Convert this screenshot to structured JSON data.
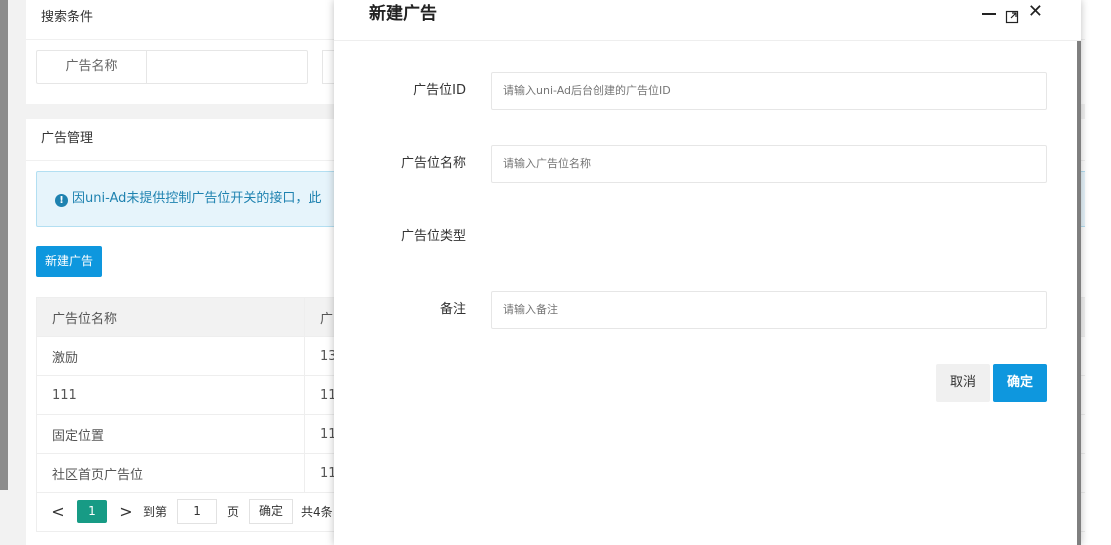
{
  "search_card": {
    "header": "搜索条件",
    "field_label": "广告名称",
    "field_value": ""
  },
  "manage_card": {
    "header": "广告管理",
    "notice": "因uni-Ad未提供控制广告位开关的接口，此",
    "new_button": "新建广告",
    "table": {
      "columns": [
        "广告位名称",
        "广"
      ],
      "rows": [
        [
          "激励",
          "13"
        ],
        [
          "111",
          "11"
        ],
        [
          "固定位置",
          "11"
        ],
        [
          "社区首页广告位",
          "11"
        ]
      ]
    },
    "pager": {
      "prev": "<",
      "current_page": "1",
      "next": ">",
      "goto_label": "到第",
      "goto_value": "1",
      "page_unit": "页",
      "confirm": "确定",
      "total": "共4条"
    }
  },
  "modal": {
    "title": "新建广告",
    "fields": [
      {
        "label": "广告位ID",
        "placeholder": "请输入uni-Ad后台创建的广告位ID"
      },
      {
        "label": "广告位名称",
        "placeholder": "请输入广告位名称"
      },
      {
        "label": "广告位类型"
      },
      {
        "label": "备注",
        "placeholder": "请输入备注"
      }
    ],
    "cancel_button": "取消",
    "ok_button": "确定"
  },
  "colors": {
    "primary": "#0e97de",
    "pager_active": "#179b85",
    "notice_bg": "#e6f4fb",
    "notice_text": "#1e82b0"
  }
}
